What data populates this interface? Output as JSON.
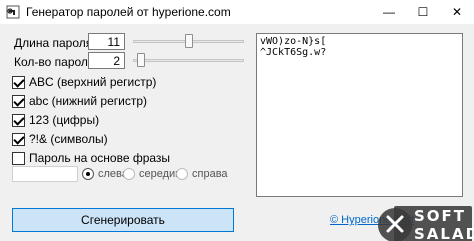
{
  "window": {
    "title": "Генератор паролей от hyperione.com",
    "min_glyph": "—",
    "max_glyph": "☐",
    "close_glyph": "✕"
  },
  "settings": {
    "length_label": "Длина пароля:",
    "length_value": "11",
    "count_label": "Кол-во паролей:",
    "count_value": "2",
    "length_slider_fraction": 0.5,
    "count_slider_fraction": 0.04
  },
  "options": [
    {
      "label": "ABC (верхний регистр)",
      "checked": true
    },
    {
      "label": "abc (нижний регистр)",
      "checked": true
    },
    {
      "label": "123 (цифры)",
      "checked": true
    },
    {
      "label": "?!& (символы)",
      "checked": true
    },
    {
      "label": "Пароль на основе фразы",
      "checked": false
    }
  ],
  "phrase": {
    "value": "",
    "positions": [
      {
        "label": "слева",
        "checked": true
      },
      {
        "label": "середина",
        "checked": false
      },
      {
        "label": "справа",
        "checked": false
      }
    ]
  },
  "output": {
    "text": "vWO)zo-N}s[\n^JCkT6Sg.w?"
  },
  "generate_label": "Сгенерировать",
  "link_text": "© Hyperione Soft",
  "watermark": {
    "line1": "SOFT",
    "line2": "SALAD"
  },
  "icons": {
    "app": "key-icon",
    "checkbox": "checkmark-icon"
  }
}
